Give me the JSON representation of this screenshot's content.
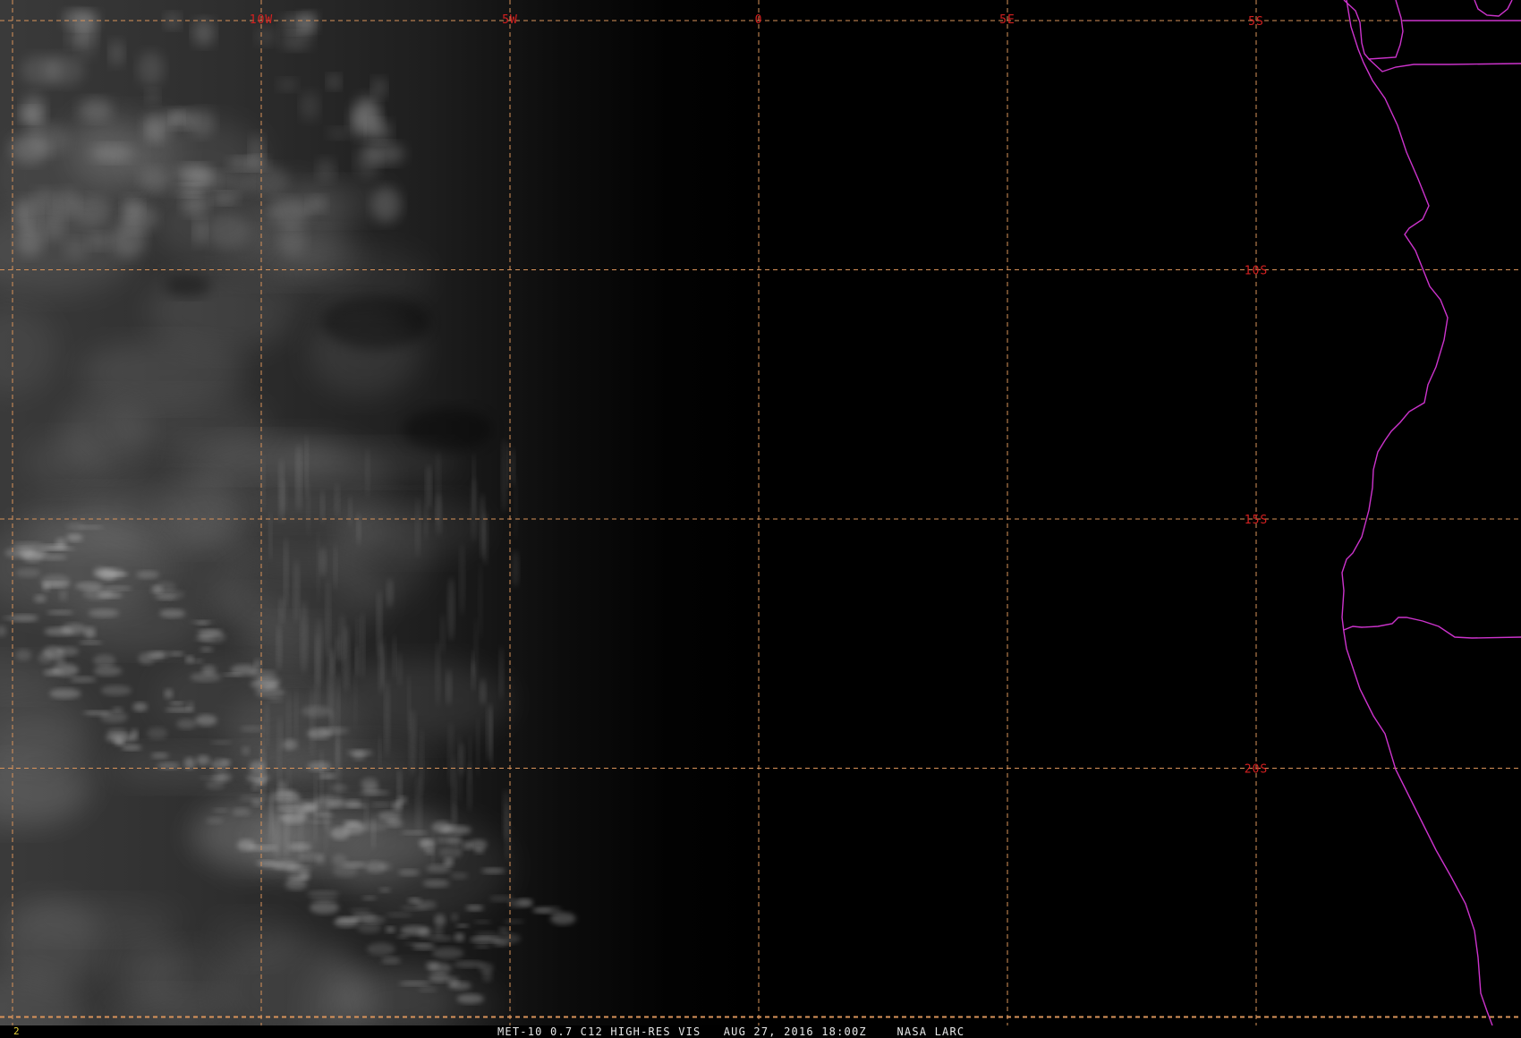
{
  "map": {
    "longitude_labels": [
      {
        "text": "10W",
        "lon": -10
      },
      {
        "text": "5W",
        "lon": -5
      },
      {
        "text": "0",
        "lon": 0
      },
      {
        "text": "5E",
        "lon": 5
      }
    ],
    "latitude_labels": [
      {
        "text": "5S",
        "lat": -5
      },
      {
        "text": "10S",
        "lat": -10
      },
      {
        "text": "15S",
        "lat": -15
      },
      {
        "text": "20S",
        "lat": -20
      }
    ],
    "colors": {
      "background": "#000000",
      "graticule": "#d9935a",
      "graticule_label": "#d42020",
      "boundary": "#cc33cc",
      "cloud": "#d8d8d8",
      "frame_number": "#e8d23a",
      "caption": "#e8e8e8"
    }
  },
  "status_bar": {
    "frame_number": "2",
    "caption": "MET-10 0.7 C12 HIGH-RES VIS   AUG 27, 2016 18:00Z    NASA LARC"
  }
}
